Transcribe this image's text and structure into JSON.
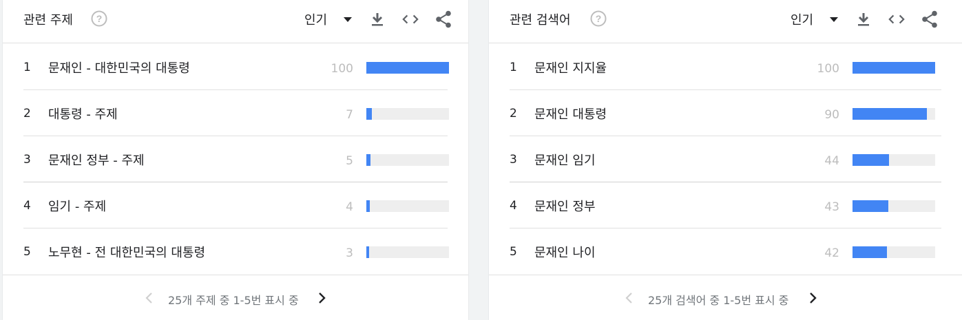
{
  "left_card": {
    "title": "관련 주제",
    "select_label": "인기",
    "rows": [
      {
        "rank": "1",
        "label": "문재인 - 대한민국의 대통령",
        "value": "100",
        "fill": 1.0
      },
      {
        "rank": "2",
        "label": "대통령 - 주제",
        "value": "7",
        "fill": 0.07
      },
      {
        "rank": "3",
        "label": "문재인 정부 - 주제",
        "value": "5",
        "fill": 0.05
      },
      {
        "rank": "4",
        "label": "임기 - 주제",
        "value": "4",
        "fill": 0.04
      },
      {
        "rank": "5",
        "label": "노무현 - 전 대한민국의 대통령",
        "value": "3",
        "fill": 0.03
      }
    ],
    "pager_text": "25개 주제 중 1-5번 표시 중"
  },
  "right_card": {
    "title": "관련 검색어",
    "select_label": "인기",
    "rows": [
      {
        "rank": "1",
        "label": "문재인 지지율",
        "value": "100",
        "fill": 1.0
      },
      {
        "rank": "2",
        "label": "문재인 대통령",
        "value": "90",
        "fill": 0.9
      },
      {
        "rank": "3",
        "label": "문재인 임기",
        "value": "44",
        "fill": 0.44
      },
      {
        "rank": "4",
        "label": "문재인 정부",
        "value": "43",
        "fill": 0.43
      },
      {
        "rank": "5",
        "label": "문재인 나이",
        "value": "42",
        "fill": 0.42
      }
    ],
    "pager_text": "25개 검색어 중 1-5번 표시 중"
  },
  "colors": {
    "bar": "#4285f4",
    "bar_track": "#eeeeee",
    "muted": "#bdbdbd",
    "icon": "#5f6368"
  },
  "icons": [
    "help-icon",
    "dropdown-caret-icon",
    "download-icon",
    "embed-code-icon",
    "share-icon",
    "chevron-left-icon",
    "chevron-right-icon"
  ]
}
